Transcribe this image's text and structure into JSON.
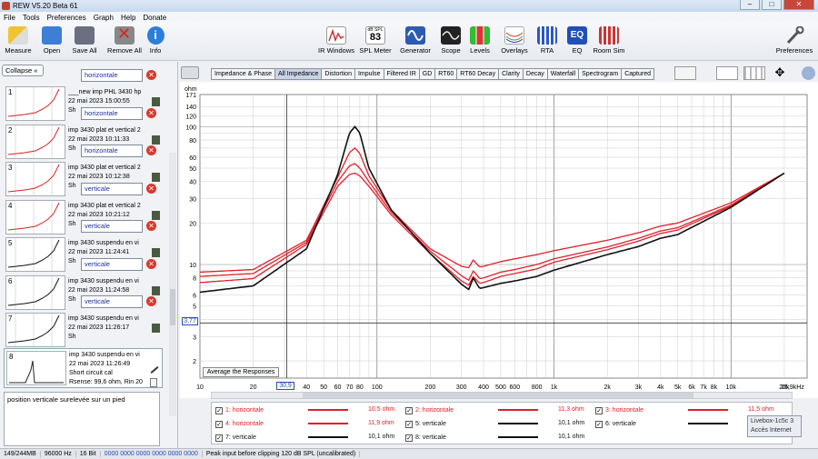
{
  "window": {
    "title": "REW V5.20 Beta 61",
    "min": "–",
    "max": "□",
    "close": "✕"
  },
  "menu": [
    "File",
    "Tools",
    "Preferences",
    "Graph",
    "Help",
    "Donate"
  ],
  "toolbar": {
    "left": [
      "Measure",
      "Open",
      "Save All",
      "Remove All",
      "Info"
    ],
    "center": [
      "IR Windows",
      "SPL Meter",
      "Generator",
      "Scope",
      "Levels",
      "Overlays",
      "RTA",
      "EQ",
      "Room Sim"
    ],
    "spl_badge_top": "dB SPL",
    "spl_badge_value": "83",
    "right": "Preferences"
  },
  "left_panel": {
    "collapse_label": "Collapse",
    "measurements": [
      {
        "num": "1",
        "label": "horizontale",
        "name": "___new imp PHL 3430 hp",
        "date": "22 mai 2023 15:00:55",
        "extra": "Sh",
        "color": "#d22"
      },
      {
        "num": "2",
        "label": "horizontale",
        "name": "imp 3430 plat et vertical 2",
        "date": "22 mai 2023 10:11:33",
        "extra": "Sh",
        "color": "#d22"
      },
      {
        "num": "3",
        "label": "horizontale",
        "name": "imp 3430 plat et vertical 2",
        "date": "22 mai 2023 10:12:38",
        "extra": "Sh",
        "color": "#d22"
      },
      {
        "num": "4",
        "label": "verticale",
        "name": "imp 3430 plat et vertical 2",
        "date": "22 mai 2023 10:21:12",
        "extra": "Sh",
        "color": "#d22"
      },
      {
        "num": "5",
        "label": "verticale",
        "name": "imp 3430 suspendu en vi",
        "date": "22 mai 2023 11:24:41",
        "extra": "Sh",
        "color": "#111"
      },
      {
        "num": "6",
        "label": "verticale",
        "name": "imp 3430 suspendu en vi",
        "date": "22 mai 2023 11:24:58",
        "extra": "Sh",
        "color": "#111"
      },
      {
        "num": "7",
        "label": "verticale",
        "name": "imp 3430 suspendu en vi",
        "date": "22 mai 2023 11:26:17",
        "extra": "Sh",
        "color": "#111"
      }
    ],
    "selected": {
      "num": "8",
      "name": "imp 3430 suspendu en vi",
      "date": "22 mai 2023 11:26:49",
      "line1": "Short circuit cal",
      "line2": "Rsense: 99,6 ohm, Rin 20"
    },
    "notes": "position verticale surelevée sur un pied"
  },
  "tabs": [
    "Impedance & Phase",
    "All Impedance",
    "Distortion",
    "Impulse",
    "Filtered IR",
    "GD",
    "RT60",
    "RT60 Decay",
    "Clarity",
    "Decay",
    "Waterfall",
    "Spectrogram",
    "Captured"
  ],
  "active_tab": "All Impedance",
  "chart_data": {
    "type": "line",
    "ylabel": "ohm",
    "xlabel": "Hz",
    "xscale": "log",
    "yscale": "log",
    "xlim": [
      10,
      26900
    ],
    "ylim": [
      1.5,
      171
    ],
    "yticks": [
      "171",
      "140",
      "120",
      "100",
      "80",
      "60",
      "50",
      "40",
      "30",
      "20",
      "10",
      "8",
      "6",
      "5",
      "4",
      "3",
      "2"
    ],
    "xticks": [
      "10",
      "20",
      "30",
      "40",
      "50",
      "60",
      "70",
      "80",
      "100",
      "200",
      "300",
      "400",
      "500",
      "600",
      "800",
      "1k",
      "2k",
      "3k",
      "4k",
      "5k",
      "6k",
      "7k",
      "8k",
      "10k",
      "20k",
      "26,9kHz"
    ],
    "cursor_x": "30,9",
    "cursor_y": "3,77",
    "average_button": "Average the Responses",
    "series": [
      {
        "color": "#111111",
        "x": [
          10,
          20,
          40,
          60,
          70,
          75,
          80,
          90,
          120,
          200,
          300,
          330,
          350,
          380,
          400,
          500,
          600,
          800,
          1000,
          2000,
          3000,
          4000,
          5000,
          10000,
          20000
        ],
        "y": [
          6.3,
          7,
          13,
          45,
          90,
          100,
          90,
          50,
          25,
          12,
          7.2,
          6.6,
          8,
          6.7,
          6.8,
          7.3,
          7.6,
          8.2,
          9.1,
          11.8,
          13.5,
          15.5,
          16.5,
          26,
          46
        ]
      },
      {
        "color": "#e0202a",
        "x": [
          10,
          20,
          40,
          60,
          70,
          75,
          80,
          90,
          120,
          200,
          300,
          330,
          350,
          380,
          400,
          500,
          600,
          800,
          1000,
          2000,
          3000,
          4000,
          5000,
          10000,
          20000
        ],
        "y": [
          8.8,
          9.2,
          15,
          43,
          65,
          70,
          64,
          44,
          25,
          13,
          9.7,
          9.5,
          10.8,
          9.6,
          9.7,
          10.5,
          11,
          11.8,
          12.6,
          15,
          17,
          19,
          20,
          28,
          46
        ]
      },
      {
        "color": "#e0202a",
        "x": [
          10,
          20,
          40,
          60,
          70,
          75,
          80,
          90,
          120,
          200,
          300,
          330,
          350,
          380,
          400,
          500,
          600,
          800,
          1000,
          2000,
          3000,
          4000,
          5000,
          10000,
          20000
        ],
        "y": [
          8.2,
          8.6,
          14.5,
          40,
          52,
          54,
          50,
          40,
          24,
          12.5,
          8.3,
          7.7,
          9,
          7.9,
          8,
          8.8,
          9.2,
          10,
          11,
          13.4,
          15.5,
          17.5,
          18.5,
          27,
          46
        ]
      },
      {
        "color": "#e0202a",
        "x": [
          10,
          20,
          40,
          60,
          70,
          75,
          80,
          90,
          120,
          200,
          300,
          330,
          350,
          380,
          400,
          500,
          600,
          800,
          1000,
          2000,
          3000,
          4000,
          5000,
          10000,
          20000
        ],
        "y": [
          7.4,
          7.9,
          14,
          37,
          45,
          46,
          44,
          37,
          23,
          12,
          7.6,
          7.1,
          8.2,
          7.3,
          7.4,
          8.2,
          8.6,
          9.3,
          10.4,
          12.8,
          14.8,
          16.8,
          17.8,
          26.5,
          46
        ]
      }
    ]
  },
  "legend": [
    {
      "num": "1",
      "label": "horizontale",
      "ohm": "10,5 ohm",
      "color": "#e0202a"
    },
    {
      "num": "2",
      "label": "horizontale",
      "ohm": "11,3 ohm",
      "color": "#e0202a"
    },
    {
      "num": "3",
      "label": "horizontale",
      "ohm": "11,5 ohm",
      "color": "#e0202a"
    },
    {
      "num": "4",
      "label": "horizontale",
      "ohm": "11,9 ohm",
      "color": "#e0202a"
    },
    {
      "num": "5",
      "label": "verticale",
      "ohm": "10,1 ohm",
      "color": "#111111"
    },
    {
      "num": "6",
      "label": "verticale",
      "ohm": "10",
      "color": "#111111"
    },
    {
      "num": "7",
      "label": "verticale",
      "ohm": "10,1 ohm",
      "color": "#111111"
    },
    {
      "num": "8",
      "label": "verticale",
      "ohm": "10,1 ohm",
      "color": "#111111"
    }
  ],
  "tooltip": {
    "line1": "Livebox-1c5c",
    "line2": "Accès Internet",
    "suffix": "3"
  },
  "status": [
    "149/244MB",
    "96000 Hz",
    "16 Bit",
    "0000 0000  0000 0000  0000 0000",
    "Peak input before clipping 120 dB SPL (uncalibrated)"
  ]
}
